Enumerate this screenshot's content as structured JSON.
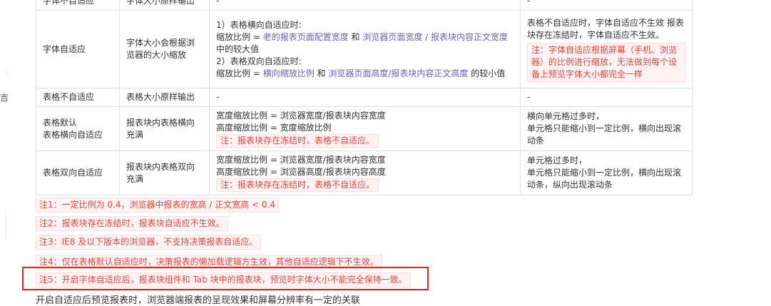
{
  "table": {
    "rows": [
      {
        "cells": [
          {
            "text": "字体不自适应"
          },
          {
            "text": "字体大小原样输出"
          },
          {
            "text": "-"
          },
          {
            "text": "-"
          }
        ]
      },
      {
        "cells": [
          {
            "text": "字体自适应"
          },
          {
            "text": "字体大小会根据浏览器的大小缩放"
          },
          {
            "lines": [
              "1）表格横向自适应时:",
              "缩放比例 = ",
              "老的报表页面配置宽度",
              " 和 ",
              "浏览器页面宽度 / 报表块内容正文宽度",
              " 中的较大值",
              "2）表格双向自适应时:",
              "缩放比例 = ",
              "横向缩放比例",
              " 和 ",
              "浏览器页面高度/报表块内容正文高度",
              " 的较小值"
            ]
          },
          {
            "text": "表格不自适应时，字体自适应不生效 报表块存在冻结时，字体自适应不生效。",
            "note": "注：字体自适应根据屏幕（手机、浏览器）的比例进行缩放，无法做到每个设备上预览字体大小都完全一样"
          }
        ]
      },
      {
        "cells": [
          {
            "text": "表格不自适应"
          },
          {
            "text": "表格大小原样输出"
          },
          {
            "text": "-"
          },
          {
            "text": "-"
          }
        ]
      },
      {
        "cells": [
          {
            "text": "表格默认\n表格横向自适应"
          },
          {
            "text": "报表块内表格横向充满"
          },
          {
            "text": "宽度缩放比例 = 浏览器宽度/报表块内容宽度\n高度缩放比例 = 宽度缩放比例",
            "note": "注：报表块存在冻结时，表格不自适应。"
          },
          {
            "text": "横向单元格过多时，\n单元格只能缩小到一定比例，横向出现滚动条"
          }
        ]
      },
      {
        "cells": [
          {
            "text": "表格双向自适应"
          },
          {
            "text": "报表块内表格双向充满"
          },
          {
            "text": "宽度缩放比例 = 浏览器宽度/报表块内容宽度\n高度缩放比例 = 浏览器高度/报表块内容高度",
            "note": "注：报表块存在冻结时，表格不自适应。"
          },
          {
            "text": "单元格过多时，\n单元格只能缩小到一定比例，横向出现滚动条，纵向出现滚动条"
          }
        ]
      }
    ]
  },
  "notes": [
    "注1：一定比例为 0.4，浏览器中报表的宽高 / 正文宽高 < 0.4",
    "注2：报表块存在冻结时，报表块自适应不生效。",
    "注3：IE8 及以下版本的浏览器，不支持决策报表自适应。",
    "注4：仅在表格默认自适应时，决策报表的懒加载逻辑方生效，其他自适应逻辑下不生效。",
    "注5：开启字体自适应后，报表块组件和 Tab 块中的报表块，预览时字体大小不能完全保持一致。"
  ],
  "bottom_text": "开启自适应后预览报表时，浏览器端报表的呈现效果和屏幕分辨率有一定的关联",
  "colors": {
    "link_purple": "#6b5fb5",
    "note_red": "#e0443e",
    "note_bg": "#fff3f3",
    "highlight_border": "#e1251b",
    "grid_border": "#e0e0e0"
  },
  "gutter": {
    "char": "吉"
  }
}
